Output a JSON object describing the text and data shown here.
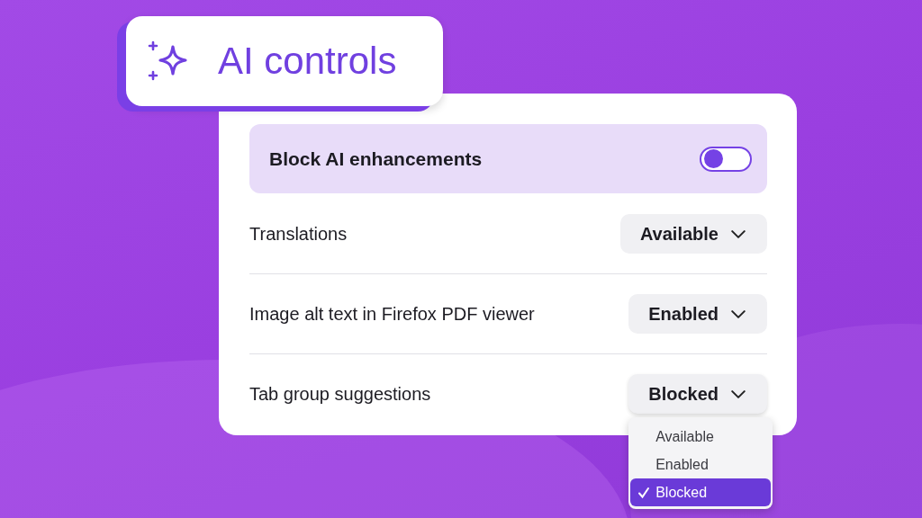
{
  "header": {
    "title": "AI controls"
  },
  "master": {
    "label": "Block AI enhancements",
    "on": false
  },
  "settings": [
    {
      "label": "Translations",
      "value": "Available",
      "expanded": false
    },
    {
      "label": "Image alt text in Firefox PDF viewer",
      "value": "Enabled",
      "expanded": false
    },
    {
      "label": "Tab group suggestions",
      "value": "Blocked",
      "expanded": true
    }
  ],
  "menu": {
    "options": [
      {
        "label": "Available",
        "selected": false
      },
      {
        "label": "Enabled",
        "selected": false
      },
      {
        "label": "Blocked",
        "selected": true
      }
    ]
  }
}
